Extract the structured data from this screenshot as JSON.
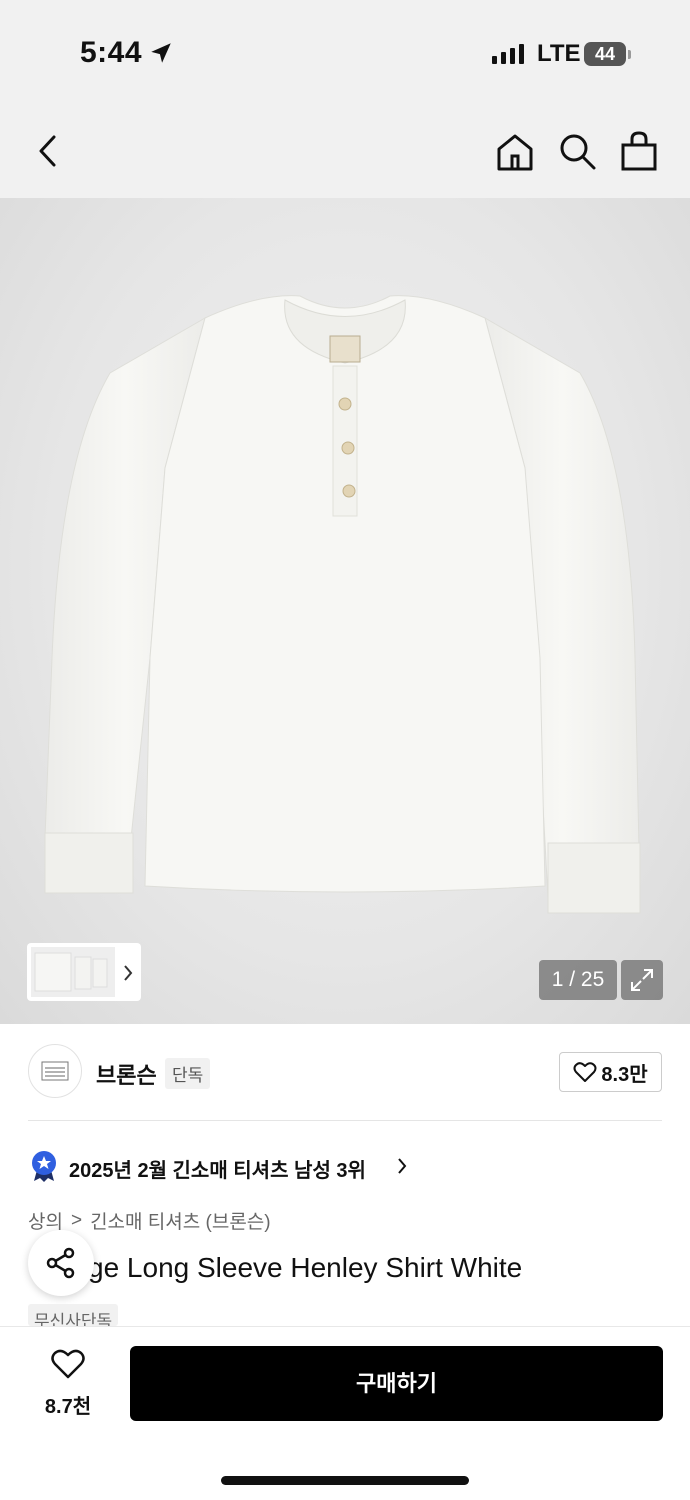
{
  "status_bar": {
    "time": "5:44",
    "network": "LTE",
    "battery": "44"
  },
  "nav": {
    "icons": [
      "back-icon",
      "home-icon",
      "search-icon",
      "bag-icon"
    ]
  },
  "gallery": {
    "counter": "1 / 25",
    "current_index": 1,
    "total": 25
  },
  "brand": {
    "logo_text": "BRONSON",
    "name": "브론슨",
    "tag": "단독",
    "likes": "8.3만"
  },
  "ranking": {
    "text": "2025년 2월 긴소매 티셔츠 남성 3위"
  },
  "breadcrumb": {
    "level1": "상의",
    "separator": ">",
    "level2": "긴소매 티셔츠 (브론슨)"
  },
  "product": {
    "title": "Vintage Long Sleeve Henley Shirt White",
    "visible_title": "ge Long Sleeve Henley Shirt White",
    "exclusive_tag": "무신사단독"
  },
  "bottom_bar": {
    "wish_count": "8.7천",
    "buy_label": "구매하기"
  },
  "colors": {
    "header_bg": "#f1f1f1",
    "buy_button": "#000000",
    "rank_badge": "#2f5fe0"
  }
}
